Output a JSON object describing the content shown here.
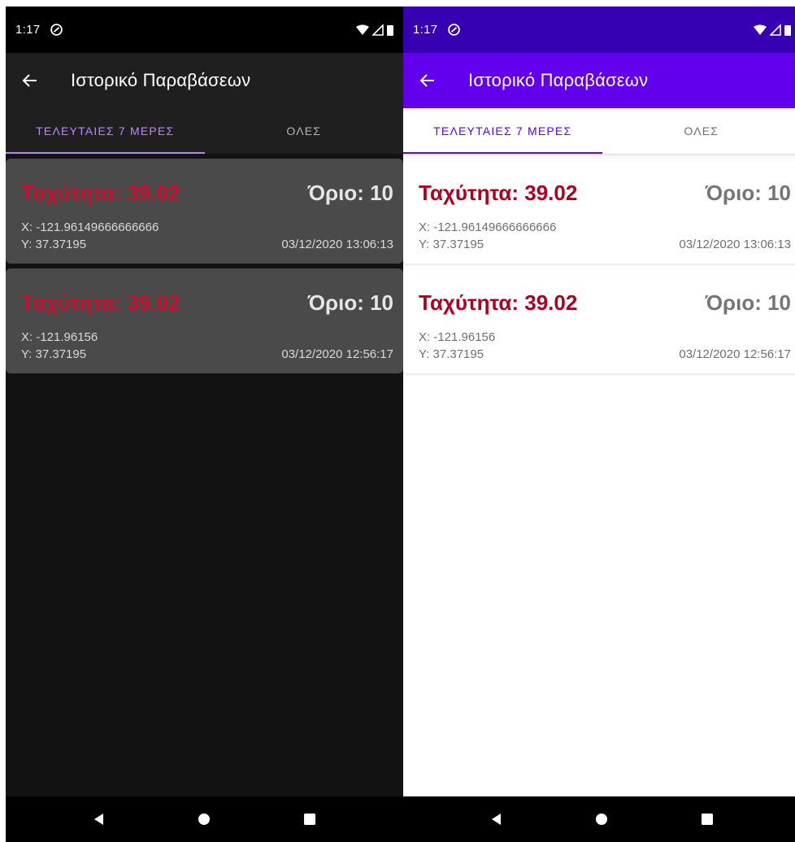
{
  "status": {
    "time": "1:17"
  },
  "app_bar": {
    "title": "Ιστορικό Παραβάσεων"
  },
  "tabs": [
    {
      "label": "ΤΕΛΕΥΤΑΙΕΣ 7 ΜΕΡΕΣ",
      "selected": true
    },
    {
      "label": "ΟΛΕΣ",
      "selected": false
    }
  ],
  "violations": [
    {
      "speed": "Ταχύτητα: 39.02",
      "limit": "Όριο: 10",
      "x": "X: -121.96149666666666",
      "y": "Y: 37.37195",
      "datetime": "03/12/2020 13:06:13"
    },
    {
      "speed": "Ταχύτητα: 39.02",
      "limit": "Όριο: 10",
      "x": "X: -121.96156",
      "y": "Y: 37.37195",
      "datetime": "03/12/2020 12:56:17"
    }
  ],
  "theme_colors": {
    "dark_background": "#121212",
    "dark_accent": "#bb86fc",
    "light_primary": "#6200ee",
    "light_status": "#3700b3",
    "speed_red": "#b00020"
  }
}
